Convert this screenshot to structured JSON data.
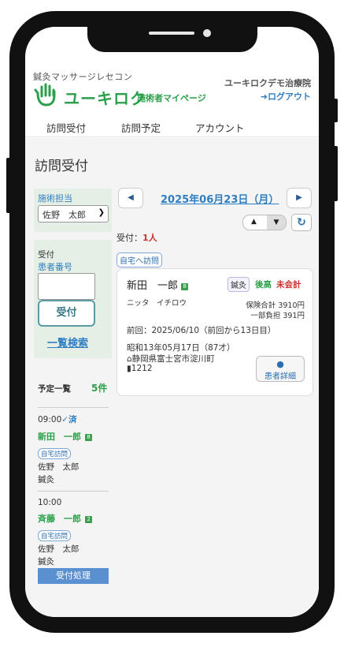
{
  "brand": {
    "tagline": "鍼灸マッサージレセコン",
    "logo_text": "ユーキロク",
    "logo_sub": "施術者マイページ",
    "clinic_name": "ユーキロクデモ治療院",
    "logout_label": "ログアウト",
    "logo_color": "#2aa04a"
  },
  "nav": {
    "items": [
      "訪問受付",
      "訪問予定",
      "アカウント"
    ]
  },
  "page": {
    "title": "訪問受付"
  },
  "left_panel": {
    "practitioner_label": "施術担当",
    "practitioner_value": "佐野　太郎",
    "reception_label": "受付",
    "patient_no_label": "患者番号",
    "patient_no_value": "",
    "reception_button": "受付",
    "list_search_link": "一覧検索"
  },
  "schedule": {
    "title": "予定一覧",
    "count": "5件",
    "items": [
      {
        "time": "09:00",
        "status": "✓済",
        "name": "新田　一郎",
        "badge": "8",
        "visit_tag": "自宅訪問",
        "practitioner": "佐野　太郎",
        "treatment": "鍼灸"
      },
      {
        "time": "10:00",
        "status": "",
        "name": "斉藤　一郎",
        "badge": "2",
        "visit_tag": "自宅訪問",
        "practitioner": "佐野　太郎",
        "treatment": "鍼灸"
      }
    ],
    "process_button": "受付処理"
  },
  "date_bar": {
    "date": "2025年06月23日（月）",
    "prev_icon": "caret-left-icon",
    "next_icon": "caret-right-icon"
  },
  "reception": {
    "count_label": "受付：",
    "count_value": "1人",
    "visit_tag": "自宅へ訪問"
  },
  "card": {
    "name": "新田　一郎",
    "badge": "8",
    "treatment_tag": "鍼灸",
    "payment_later": "後高",
    "unpaid": "未会計",
    "kana": "ニッタ　イチロウ",
    "insurance_total": "保険合計 3910円",
    "copay": "一部負担 391円",
    "previous_visit": "前回：2025/06/10（前回から13日目）",
    "birth": "昭和13年05月17日（87才）",
    "address": "静岡県富士宮市淀川町",
    "room": "1212",
    "detail_button": "患者詳細"
  }
}
